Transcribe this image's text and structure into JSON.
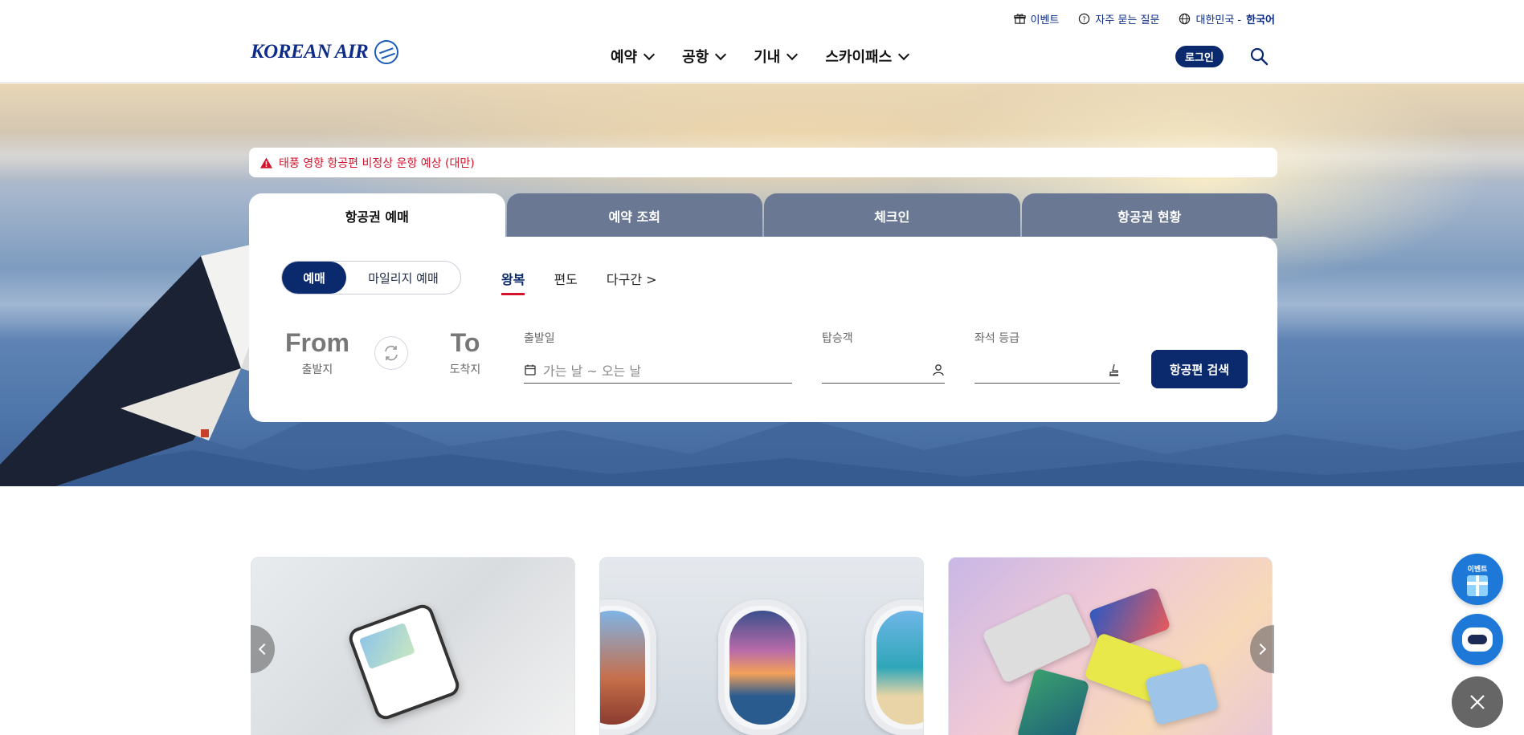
{
  "utility": {
    "event": "이벤트",
    "faq": "자주 묻는 질문",
    "region": "대한민국 -",
    "language": "한국어"
  },
  "brand": {
    "logo_text": "KOREAN AIR"
  },
  "nav": {
    "items": [
      {
        "label": "예약"
      },
      {
        "label": "공항"
      },
      {
        "label": "기내"
      },
      {
        "label": "스카이패스"
      }
    ],
    "login": "로그인"
  },
  "alert": {
    "text": "태풍 영향 항공편 비정상 운항 예상 (대만)"
  },
  "tabs": [
    {
      "label": "항공권 예매",
      "active": true
    },
    {
      "label": "예약 조회",
      "active": false
    },
    {
      "label": "체크인",
      "active": false
    },
    {
      "label": "항공권 현황",
      "active": false
    }
  ],
  "booking": {
    "mode_options": [
      "예매",
      "마일리지 예매"
    ],
    "selected_mode": "예매",
    "trip_types": [
      "왕복",
      "편도",
      "다구간 >"
    ],
    "selected_trip": "왕복",
    "from": {
      "code": "From",
      "label": "출발지"
    },
    "to": {
      "code": "To",
      "label": "도착지"
    },
    "date": {
      "label": "출발일",
      "placeholder": "가는 날 ~ 오는 날"
    },
    "passengers": {
      "label": "탑승객",
      "value": ""
    },
    "cabin": {
      "label": "좌석 등급",
      "value": ""
    },
    "search_button": "항공편 검색"
  },
  "floating": {
    "event_caption": "이벤트"
  },
  "colors": {
    "brand_navy": "#0b2a6e",
    "alert_red": "#d2142c",
    "tab_inactive": "#6a7893",
    "float_blue": "#1e78d8"
  }
}
